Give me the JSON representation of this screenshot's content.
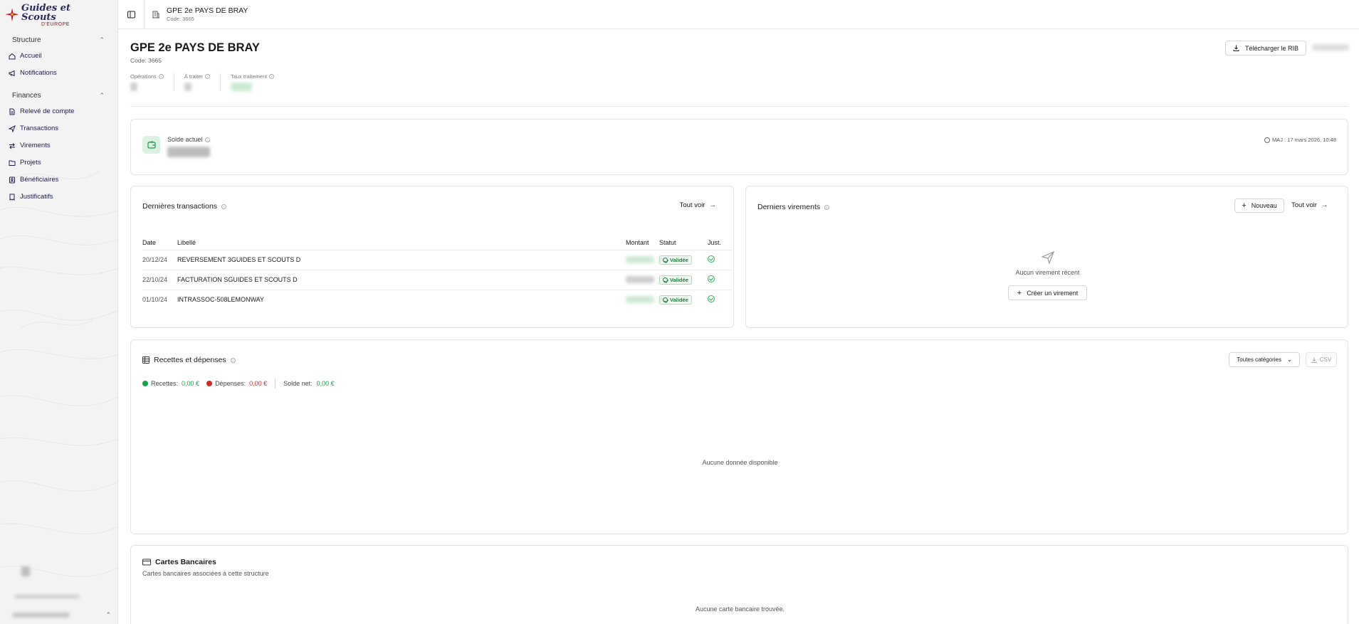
{
  "brand": {
    "name": "Guides et Scouts",
    "sub": "D'EUROPE"
  },
  "sidebar": {
    "sections": [
      {
        "title": "Structure",
        "items": [
          {
            "label": "Accueil",
            "icon": "home-icon"
          },
          {
            "label": "Notifications",
            "icon": "megaphone-icon"
          }
        ]
      },
      {
        "title": "Finances",
        "items": [
          {
            "label": "Relevé de compte",
            "icon": "document-icon"
          },
          {
            "label": "Transactions",
            "icon": "send-icon"
          },
          {
            "label": "Virements",
            "icon": "transfer-icon"
          },
          {
            "label": "Projets",
            "icon": "folder-icon"
          },
          {
            "label": "Bénéficiaires",
            "icon": "contacts-icon"
          },
          {
            "label": "Justificatifs",
            "icon": "receipt-icon"
          }
        ]
      }
    ]
  },
  "topbar": {
    "title": "GPE 2e PAYS DE BRAY",
    "code": "Code: 3665"
  },
  "header": {
    "title": "GPE 2e PAYS DE BRAY",
    "code": "Code: 3665",
    "download_rib": "Télécharger le RIB",
    "stats": [
      {
        "label": "Opérations"
      },
      {
        "label": "À traiter"
      },
      {
        "label": "Taux traitement"
      }
    ]
  },
  "balance": {
    "label": "Solde actuel",
    "updated": "MAJ : 17 mars 2026, 10:48"
  },
  "transactions": {
    "title": "Dernières transactions",
    "see_all": "Tout voir",
    "columns": [
      "Date",
      "Libellé",
      "Montant",
      "Statut",
      "Just."
    ],
    "rows": [
      {
        "date": "20/12/24",
        "label": "REVERSEMENT 3GUIDES ET SCOUTS D",
        "status": "Validée"
      },
      {
        "date": "22/10/24",
        "label": "FACTURATION SGUIDES ET SCOUTS D",
        "status": "Validée"
      },
      {
        "date": "01/10/24",
        "label": "INTRASSOC-508LEMONWAY",
        "status": "Validée"
      }
    ]
  },
  "transfers": {
    "title": "Derniers virements",
    "new_label": "Nouveau",
    "see_all": "Tout voir",
    "empty": "Aucun virement récent",
    "create": "Créer un virement"
  },
  "income": {
    "title": "Recettes et dépenses",
    "filter": "Toutes catégories",
    "csv": "CSV",
    "income_label": "Recettes:",
    "income_value": "0,00 €",
    "expense_label": "Dépenses:",
    "expense_value": "0,00 €",
    "net_label": "Solde net:",
    "net_value": "0,00 €",
    "empty": "Aucune donnée disponible",
    "colors": {
      "income": "#16a34a",
      "expense": "#dc2626"
    }
  },
  "cards": {
    "title": "Cartes Bancaires",
    "subtitle": "Cartes bancaires associées à cette structure",
    "empty": "Aucune carte bancaire trouvée."
  }
}
